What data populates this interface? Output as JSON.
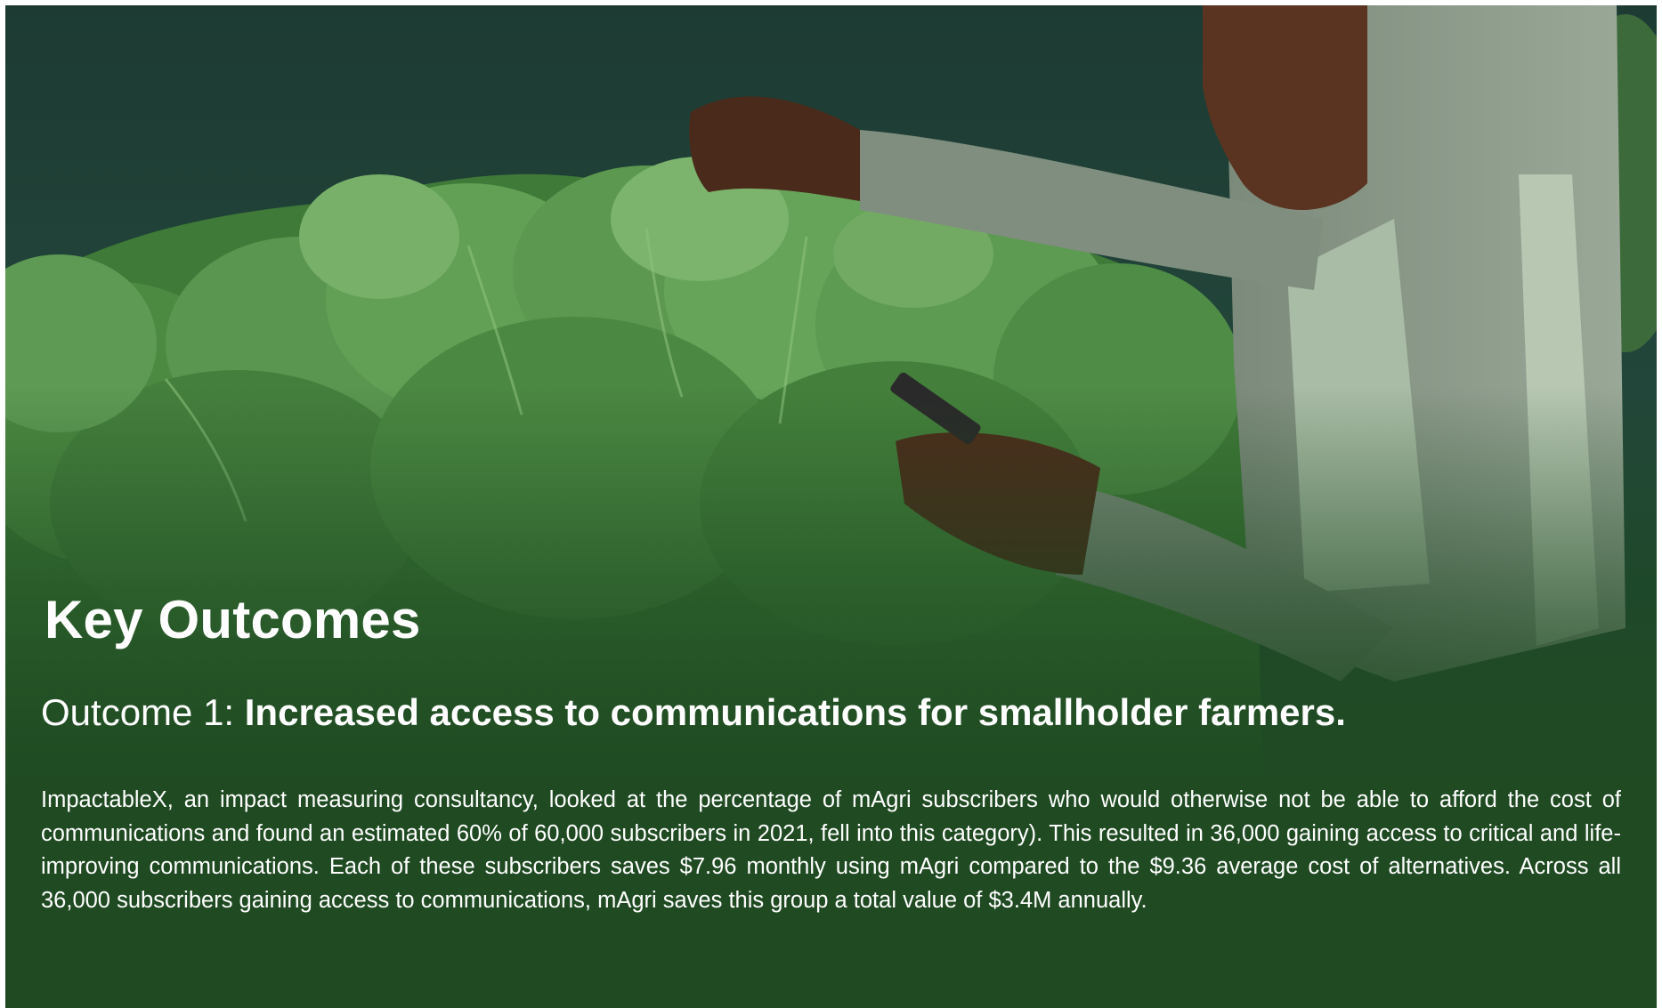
{
  "colors": {
    "panel_green": "#1f4a22",
    "text": "#ffffff",
    "leaf_green": "#4f8a45",
    "sweater_grey": "#8d9c8c"
  },
  "image": {
    "description_icon": "photo-farmer-with-phone-and-greens-icon"
  },
  "section": {
    "heading": "Key Outcomes",
    "outcome_label": "Outcome 1: ",
    "outcome_title": "Increased access to communications for smallholder farmers.",
    "body": "ImpactableX, an impact measuring consultancy, looked at the percentage of mAgri subscribers who would otherwise not be able to afford the cost of communications and found an estimated 60% of 60,000 subscribers in 2021, fell into this category). This resulted in 36,000 gaining access to critical and life-improving communications. Each of these subscribers saves $7.96 monthly using mAgri compared to the $9.36 average cost of alternatives. Across all 36,000 subscribers gaining access to communications, mAgri saves this group a total value of $3.4M annually."
  }
}
